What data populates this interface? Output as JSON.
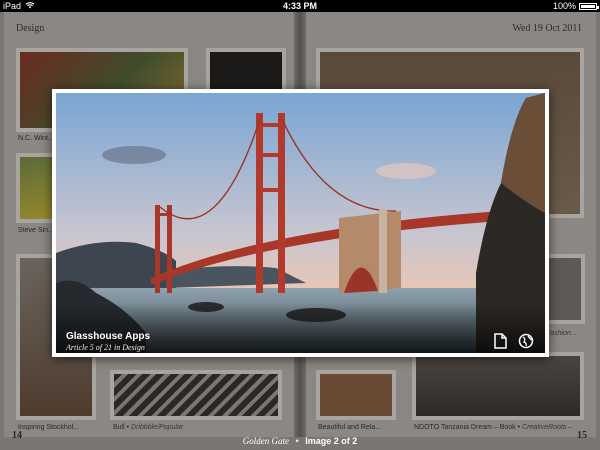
{
  "status_bar": {
    "device": "iPad",
    "time": "4:33 PM",
    "battery": "100%",
    "battery_level": 1.0
  },
  "background": {
    "section": "Design",
    "date": "Wed 19 Oct 2011",
    "page_left": "14",
    "page_right": "15",
    "captions": {
      "a": "N.C. Wint...",
      "b": "Steve Sin...",
      "c": "Inspiring Stockhol...",
      "d_title": "Bull",
      "d_source": "Dribbble/Popular",
      "e": "Beautiful and Rela...",
      "f_title": "NDOTO Tanzania Dream – Book",
      "f_source": "CreativeRoots –",
      "g": "Fashion..."
    }
  },
  "viewer": {
    "article_title": "Glasshouse Apps",
    "article_subtitle": "Article 5 of 21 in Design",
    "icons": {
      "share": "page-icon",
      "web": "globe-icon"
    }
  },
  "bottom_bar": {
    "image_title": "Golden Gate",
    "separator": "•",
    "image_counter": "Image 2 of 2"
  }
}
